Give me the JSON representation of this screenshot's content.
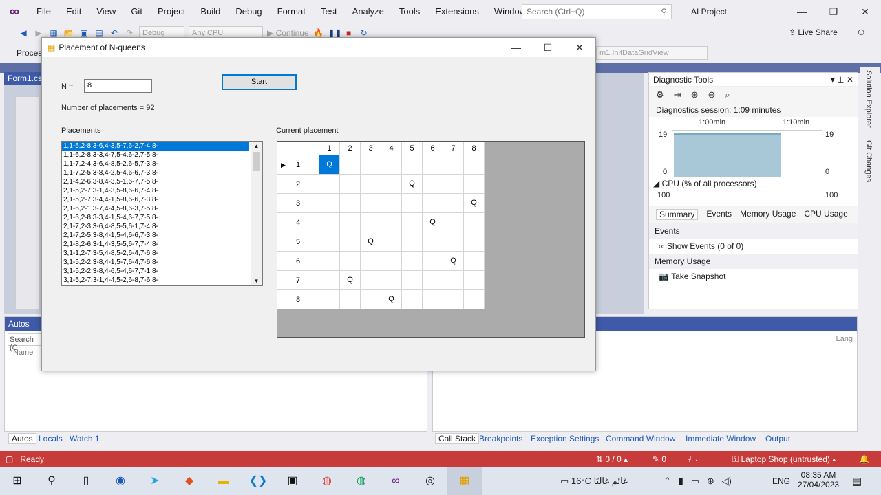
{
  "vs": {
    "menu": [
      "File",
      "Edit",
      "View",
      "Git",
      "Project",
      "Build",
      "Debug",
      "Format",
      "Test",
      "Analyze",
      "Tools",
      "Extensions",
      "Window",
      "Help"
    ],
    "search_placeholder": "Search (Ctrl+Q)",
    "project_name": "AI Project",
    "toolbar": {
      "config": "Debug",
      "platform": "Any CPU",
      "continue": "Continue",
      "live_share": "Live Share"
    },
    "toolbar2": {
      "process_label": "Process:",
      "member_combo": "m1.InitDataGridView"
    },
    "doc_tab": "Form1.cs",
    "diagnostic": {
      "title": "Diagnostic Tools",
      "session": "Diagnostics session: 1:09 minutes",
      "time1": "1:00min",
      "time2": "1:10min",
      "mem_max": "19",
      "mem_min": "0",
      "cpu_label": "CPU (% of all processors)",
      "cpu_max": "100",
      "tabs": [
        "Summary",
        "Events",
        "Memory Usage",
        "CPU Usage"
      ],
      "events_h": "Events",
      "show_events": "Show Events (0 of 0)",
      "memory_h": "Memory Usage",
      "take_snapshot": "Take Snapshot"
    },
    "side_tabs": [
      "Solution Explorer",
      "Git Changes"
    ],
    "autos": {
      "title": "Autos",
      "search": "Search (C",
      "col_name": "Name",
      "col_lang": "Lang"
    },
    "bottom_tabs_left": [
      "Autos",
      "Locals",
      "Watch 1"
    ],
    "bottom_tabs_right": [
      "Call Stack",
      "Breakpoints",
      "Exception Settings",
      "Command Window",
      "Immediate Window",
      "Output"
    ],
    "status": {
      "ready": "Ready",
      "lines": "0 / 0",
      "edits": "0",
      "repo": "Laptop Shop (untrusted)"
    },
    "taskbar": {
      "weather": "16°C غائم غالبًا",
      "lang": "ENG",
      "time": "08:35 AM",
      "date": "27/04/2023"
    }
  },
  "form": {
    "title": "Placement of N-queens",
    "n_label": "N =",
    "n_value": "8",
    "start": "Start",
    "count_label": "Number of placements = 92",
    "placements_label": "Placements",
    "current_label": "Current placement",
    "placements": [
      "1,1-5,2-8,3-6,4-3,5-7,6-2,7-4,8-",
      "1,1-6,2-8,3-3,4-7,5-4,6-2,7-5,8-",
      "1,1-7,2-4,3-6,4-8,5-2,6-5,7-3,8-",
      "1,1-7,2-5,3-8,4-2,5-4,6-6,7-3,8-",
      "2,1-4,2-6,3-8,4-3,5-1,6-7,7-5,8-",
      "2,1-5,2-7,3-1,4-3,5-8,6-6,7-4,8-",
      "2,1-5,2-7,3-4,4-1,5-8,6-6,7-3,8-",
      "2,1-6,2-1,3-7,4-4,5-8,6-3,7-5,8-",
      "2,1-6,2-8,3-3,4-1,5-4,6-7,7-5,8-",
      "2,1-7,2-3,3-6,4-8,5-5,6-1,7-4,8-",
      "2,1-7,2-5,3-8,4-1,5-4,6-6,7-3,8-",
      "2,1-8,2-6,3-1,4-3,5-5,6-7,7-4,8-",
      "3,1-1,2-7,3-5,4-8,5-2,6-4,7-6,8-",
      "3,1-5,2-2,3-8,4-1,5-7,6-4,7-6,8-",
      "3,1-5,2-2,3-8,4-6,5-4,6-7,7-1,8-",
      "3,1-5,2-7,3-1,4-4,5-2,6-8,7-6,8-"
    ],
    "board": {
      "cols": [
        "1",
        "2",
        "3",
        "4",
        "5",
        "6",
        "7",
        "8"
      ],
      "rows": [
        "1",
        "2",
        "3",
        "4",
        "5",
        "6",
        "7",
        "8"
      ],
      "queens": [
        1,
        5,
        8,
        6,
        3,
        7,
        2,
        4
      ],
      "queen_char": "Q"
    }
  }
}
